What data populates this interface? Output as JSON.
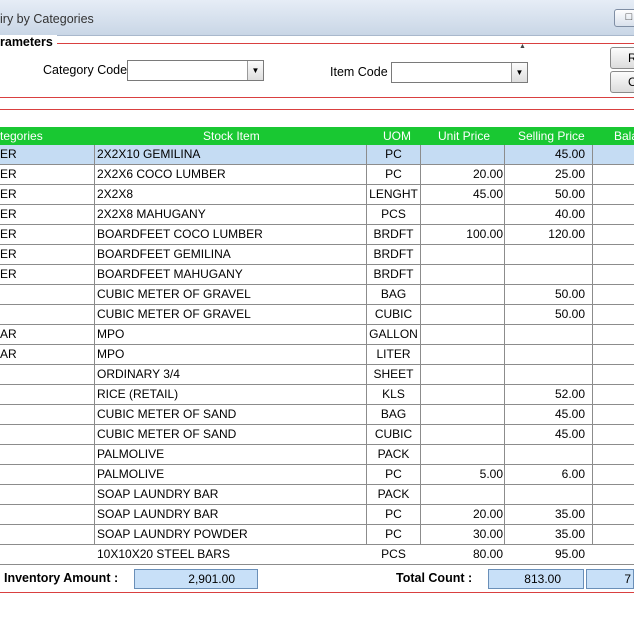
{
  "window": {
    "title": "iry by Categories",
    "button": "□"
  },
  "params": {
    "legend": "rameters",
    "category_code_label": "Category Code",
    "category_code_value": "",
    "item_code_label": "Item Code",
    "item_code_value": "",
    "button1": "R",
    "button2": "C"
  },
  "grid": {
    "headers": [
      "tegories",
      "Stock Item",
      "UOM",
      "Unit Price",
      "Selling Price",
      "Bala"
    ],
    "rows": [
      {
        "cat": "ER",
        "item": "2X2X10 GEMILINA",
        "uom": "PC",
        "unit": "",
        "sell": "45.00"
      },
      {
        "cat": "ER",
        "item": "2X2X6 COCO LUMBER",
        "uom": "PC",
        "unit": "20.00",
        "sell": "25.00"
      },
      {
        "cat": "ER",
        "item": "2X2X8",
        "uom": "LENGHT",
        "unit": "45.00",
        "sell": "50.00"
      },
      {
        "cat": "ER",
        "item": "2X2X8 MAHUGANY",
        "uom": "PCS",
        "unit": "",
        "sell": "40.00"
      },
      {
        "cat": "ER",
        "item": "BOARDFEET COCO LUMBER",
        "uom": "BRDFT",
        "unit": "100.00",
        "sell": "120.00"
      },
      {
        "cat": "ER",
        "item": "BOARDFEET GEMILINA",
        "uom": "BRDFT",
        "unit": "",
        "sell": ""
      },
      {
        "cat": "ER",
        "item": "BOARDFEET MAHUGANY",
        "uom": "BRDFT",
        "unit": "",
        "sell": ""
      },
      {
        "cat": "",
        "item": "CUBIC METER OF GRAVEL",
        "uom": "BAG",
        "unit": "",
        "sell": "50.00"
      },
      {
        "cat": "",
        "item": "CUBIC METER OF GRAVEL",
        "uom": "CUBIC",
        "unit": "",
        "sell": "50.00"
      },
      {
        "cat": "AR",
        "item": "MPO",
        "uom": "GALLON",
        "unit": "",
        "sell": ""
      },
      {
        "cat": "AR",
        "item": "MPO",
        "uom": "LITER",
        "unit": "",
        "sell": ""
      },
      {
        "cat": "",
        "item": "ORDINARY 3/4",
        "uom": "SHEET",
        "unit": "",
        "sell": ""
      },
      {
        "cat": "",
        "item": "RICE (RETAIL)",
        "uom": "KLS",
        "unit": "",
        "sell": "52.00"
      },
      {
        "cat": "",
        "item": "CUBIC METER OF SAND",
        "uom": "BAG",
        "unit": "",
        "sell": "45.00"
      },
      {
        "cat": "",
        "item": "CUBIC METER OF SAND",
        "uom": "CUBIC",
        "unit": "",
        "sell": "45.00"
      },
      {
        "cat": "",
        "item": "PALMOLIVE",
        "uom": "PACK",
        "unit": "",
        "sell": ""
      },
      {
        "cat": "",
        "item": "PALMOLIVE",
        "uom": "PC",
        "unit": "5.00",
        "sell": "6.00"
      },
      {
        "cat": "",
        "item": "SOAP LAUNDRY BAR",
        "uom": "PACK",
        "unit": "",
        "sell": ""
      },
      {
        "cat": "",
        "item": "SOAP LAUNDRY BAR",
        "uom": "PC",
        "unit": "20.00",
        "sell": "35.00"
      },
      {
        "cat": "",
        "item": "SOAP LAUNDRY POWDER",
        "uom": "PC",
        "unit": "30.00",
        "sell": "35.00"
      },
      {
        "cat": "",
        "item": "10X10X20 STEEL BARS",
        "uom": "PCS",
        "unit": "80.00",
        "sell": "95.00"
      }
    ]
  },
  "footer": {
    "inventory_label": "Inventory Amount :",
    "inventory_value": "2,901.00",
    "total_count_label": "Total Count  :",
    "total_count_value": "813.00",
    "extra_value": "7"
  }
}
